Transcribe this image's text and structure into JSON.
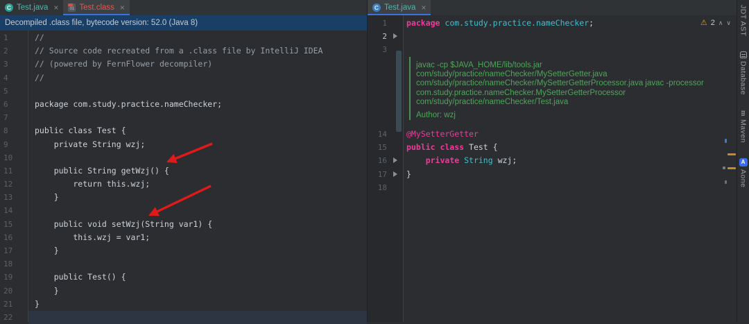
{
  "icons": {
    "close": "×",
    "warning": "⚠",
    "chevron_up": "∧",
    "chevron_down": "∨",
    "java_class_letter": "C",
    "class_file_text": "01",
    "maven_letter": "m",
    "aone_letter": "A"
  },
  "left_pane": {
    "tabs": [
      {
        "label": "Test.java"
      },
      {
        "label": "Test.class"
      }
    ],
    "banner": "Decompiled .class file, bytecode version: 52.0 (Java 8)",
    "code_lines": [
      {
        "n": "1",
        "tokens": [
          {
            "t": "comment",
            "s": "//"
          }
        ]
      },
      {
        "n": "2",
        "tokens": [
          {
            "t": "comment",
            "s": "// Source code recreated from a .class file by IntelliJ IDEA"
          }
        ]
      },
      {
        "n": "3",
        "tokens": [
          {
            "t": "comment",
            "s": "// (powered by FernFlower decompiler)"
          }
        ]
      },
      {
        "n": "4",
        "tokens": [
          {
            "t": "comment",
            "s": "//"
          }
        ]
      },
      {
        "n": "5",
        "tokens": []
      },
      {
        "n": "6",
        "tokens": [
          {
            "t": "plain",
            "s": "package com.study.practice.nameChecker;"
          }
        ]
      },
      {
        "n": "7",
        "tokens": []
      },
      {
        "n": "8",
        "tokens": [
          {
            "t": "plain",
            "s": "public class Test {"
          }
        ]
      },
      {
        "n": "9",
        "tokens": [
          {
            "t": "plain",
            "s": "    private String wzj;"
          }
        ]
      },
      {
        "n": "10",
        "tokens": []
      },
      {
        "n": "11",
        "tokens": [
          {
            "t": "plain",
            "s": "    public String getWzj() {"
          }
        ]
      },
      {
        "n": "12",
        "tokens": [
          {
            "t": "plain",
            "s": "        return this.wzj;"
          }
        ]
      },
      {
        "n": "13",
        "tokens": [
          {
            "t": "plain",
            "s": "    }"
          }
        ]
      },
      {
        "n": "14",
        "tokens": []
      },
      {
        "n": "15",
        "tokens": [
          {
            "t": "plain",
            "s": "    public void setWzj(String var1) {"
          }
        ]
      },
      {
        "n": "16",
        "tokens": [
          {
            "t": "plain",
            "s": "        this.wzj = var1;"
          }
        ]
      },
      {
        "n": "17",
        "tokens": [
          {
            "t": "plain",
            "s": "    }"
          }
        ]
      },
      {
        "n": "18",
        "tokens": []
      },
      {
        "n": "19",
        "tokens": [
          {
            "t": "plain",
            "s": "    public Test() {"
          }
        ]
      },
      {
        "n": "20",
        "tokens": [
          {
            "t": "plain",
            "s": "    }"
          }
        ]
      },
      {
        "n": "21",
        "tokens": [
          {
            "t": "plain",
            "s": "}"
          }
        ]
      },
      {
        "n": "22",
        "tokens": [],
        "current": true
      }
    ]
  },
  "right_pane": {
    "tab": {
      "label": "Test.java"
    },
    "inspection": {
      "warning_count": "2"
    },
    "code_top": [
      {
        "n": "1",
        "tokens": [
          {
            "t": "kw",
            "s": "package"
          },
          {
            "t": "plain",
            "s": " "
          },
          {
            "t": "pkg",
            "s": "com.study.practice.nameChecker"
          },
          {
            "t": "plain",
            "s": ";"
          }
        ]
      },
      {
        "n": "2",
        "tokens": [],
        "current": true,
        "fold": true
      },
      {
        "n": "3",
        "tokens": []
      }
    ],
    "doc_comment": {
      "lines": [
        "javac -cp $JAVA_HOME/lib/tools.jar",
        "com/study/practice/nameChecker/MySetterGetter.java",
        "com/study/practice/nameChecker/MySetterGetterProcessor.java javac -processor",
        "com.study.practice.nameChecker.MySetterGetterProcessor",
        "com/study/practice/nameChecker/Test.java"
      ],
      "author": "Author: wzj"
    },
    "code_bottom": [
      {
        "n": "14",
        "tokens": [
          {
            "t": "ann",
            "s": "@MySetterGetter"
          }
        ]
      },
      {
        "n": "15",
        "tokens": [
          {
            "t": "kw",
            "s": "public class"
          },
          {
            "t": "plain",
            "s": " Test {"
          }
        ]
      },
      {
        "n": "16",
        "tokens": [
          {
            "t": "plain",
            "s": "    "
          },
          {
            "t": "kw",
            "s": "private"
          },
          {
            "t": "plain",
            "s": " "
          },
          {
            "t": "type",
            "s": "String"
          },
          {
            "t": "plain",
            "s": " wzj;"
          }
        ],
        "fold": true
      },
      {
        "n": "17",
        "tokens": [
          {
            "t": "plain",
            "s": "}"
          }
        ],
        "fold": true
      },
      {
        "n": "18",
        "tokens": []
      }
    ]
  },
  "tool_stripe": {
    "items": [
      {
        "label": "JDT AST",
        "icon": "none"
      },
      {
        "label": "Database",
        "icon": "database"
      },
      {
        "label": "Maven",
        "icon": "maven"
      },
      {
        "label": "Aone",
        "icon": "aone"
      }
    ]
  },
  "colors": {
    "tab_underline": "#3c72dd",
    "keyword_pink": "#f0399b",
    "type_cyan": "#3fc0d0",
    "doc_green": "#4fa65a",
    "tab_class_red": "#e8564e",
    "tab_java_teal": "#4db6ac",
    "arrow_red": "#e01a1a",
    "banner_bg": "#1a3f66",
    "warning_yellow": "#d9a12c"
  }
}
